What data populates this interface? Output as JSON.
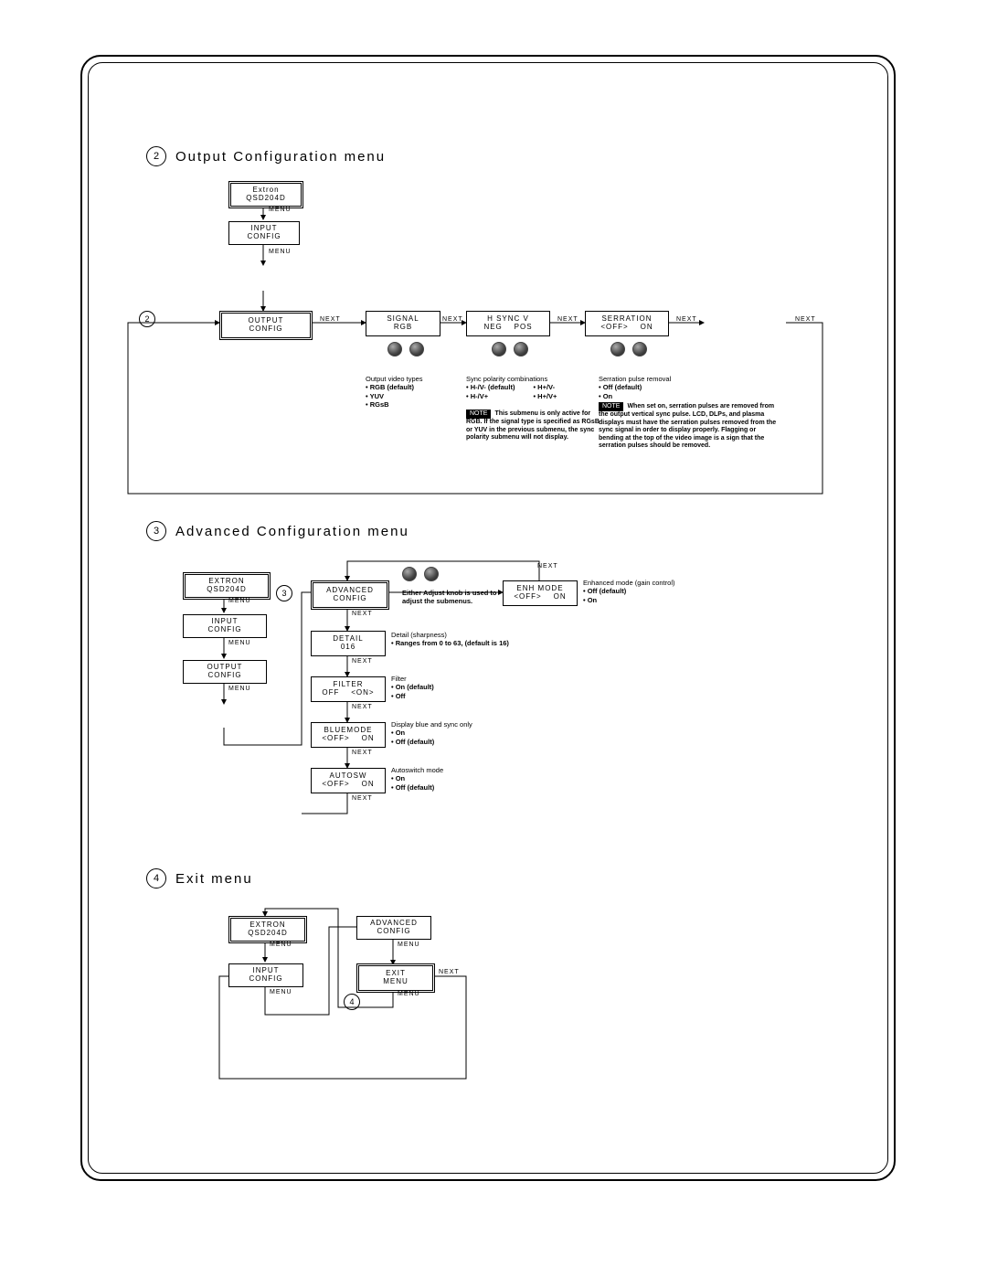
{
  "section2": {
    "num": "2",
    "title": "Output Configuration menu",
    "root_box": "Extron\nQSD204D",
    "input_box": "INPUT\nCONFIG",
    "output_box": "OUTPUT\nCONFIG",
    "signal_box": "SIGNAL\nRGB",
    "hsync_box": "H SYNC V\nNEG    POS",
    "serration_box": "SERRATION\n<OFF>    ON",
    "menu_lbl": "MENU",
    "next_lbl": "NEXT",
    "out_video_hdr": "Output video types",
    "out_video_items": "• RGB (default)\n• YUV\n• RGsB",
    "sync_hdr": "Sync polarity combinations",
    "sync_items_l": "• H-/V- (default)\n• H-/V+",
    "sync_items_r": "• H+/V-\n• H+/V+",
    "serr_hdr": "Serration pulse removal",
    "serr_items": "• Off (default)\n• On",
    "note_badge": "NOTE",
    "sync_note": "This submenu is only active for RGB. If the signal type is specified as RGsB or YUV in the previous submenu, the sync polarity submenu will not display.",
    "serr_note": "When set on, serration pulses are removed from the output vertical sync pulse. LCD, DLPs, and plasma displays must have the serration pulses removed from the sync signal in order to display properly. Flagging or bending at the top of the video image is a sign that the serration pulses should be removed."
  },
  "section3": {
    "num": "3",
    "title": "Advanced Configuration menu",
    "root_box": "EXTRON\nQSD204D",
    "input_box": "INPUT\nCONFIG",
    "output_box": "OUTPUT\nCONFIG",
    "advanced_box": "ADVANCED\nCONFIG",
    "detail_box": "DETAIL\n016",
    "filter_box": "FILTER\nOFF    <ON>",
    "bluemode_box": "BLUEMODE\n<OFF>    ON",
    "autosw_box": "AUTOSW\n<OFF>    ON",
    "enh_box": "ENH MODE\n<OFF>    ON",
    "menu_lbl": "MENU",
    "next_lbl": "NEXT",
    "knob_note": "Either Adjust knob is used to adjust the submenus.",
    "enh_desc_hdr": "Enhanced mode (gain control)",
    "enh_desc_items": "• Off (default)\n• On",
    "detail_desc_hdr": "Detail (sharpness)",
    "detail_desc_items": "• Ranges from 0 to 63, (default is 16)",
    "filter_desc_hdr": "Filter",
    "filter_desc_items": "• On (default)\n• Off",
    "blue_desc_hdr": "Display blue and sync only",
    "blue_desc_items": "• On\n• Off (default)",
    "auto_desc_hdr": "Autoswitch mode",
    "auto_desc_items": "• On\n• Off (default)"
  },
  "section4": {
    "num": "4",
    "title": "Exit menu",
    "root_box": "EXTRON\nQSD204D",
    "input_box": "INPUT\nCONFIG",
    "advanced_box": "ADVANCED\nCONFIG",
    "exit_box": "EXIT\nMENU",
    "menu_lbl": "MENU",
    "next_lbl": "NEXT"
  }
}
